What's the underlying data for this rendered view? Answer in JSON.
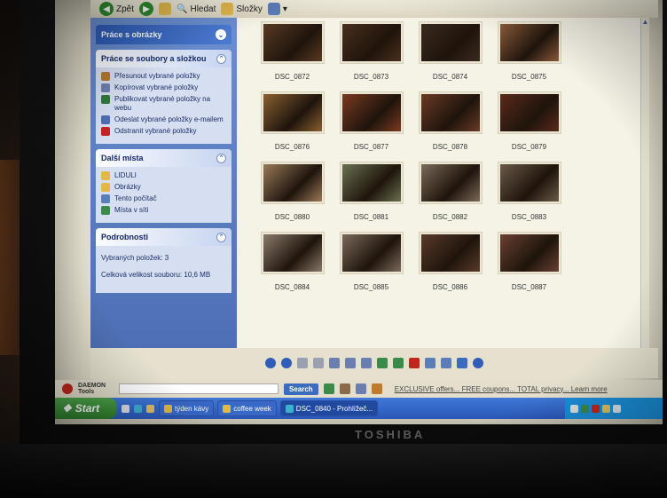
{
  "toolbar": {
    "back_label": "Zpět",
    "search_label": "Hledat",
    "folders_label": "Složky"
  },
  "taskpane": {
    "picture_tasks_title": "Práce s obrázky",
    "file_tasks": {
      "title": "Práce se soubory a složkou",
      "items": [
        {
          "label": "Přesunout vybrané položky",
          "icon": "move-icon",
          "color": "#b57a2e"
        },
        {
          "label": "Kopírovat vybrané položky",
          "icon": "copy-icon",
          "color": "#6f7fb0"
        },
        {
          "label": "Publikovat vybrané položky na webu",
          "icon": "publish-web-icon",
          "color": "#2f7a3a"
        },
        {
          "label": "Odeslat vybrané položky e-mailem",
          "icon": "email-icon",
          "color": "#4d6fb4"
        },
        {
          "label": "Odstranit vybrané položky",
          "icon": "delete-icon",
          "color": "#c0261c"
        }
      ]
    },
    "other_places": {
      "title": "Další místa",
      "items": [
        {
          "label": "LIDULI",
          "icon": "folder-icon",
          "color": "#e1b84a"
        },
        {
          "label": "Obrázky",
          "icon": "folder-icon",
          "color": "#e1b84a"
        },
        {
          "label": "Tento počítač",
          "icon": "computer-icon",
          "color": "#5b7db8"
        },
        {
          "label": "Místa v síti",
          "icon": "network-icon",
          "color": "#3b8a4a"
        }
      ]
    },
    "details": {
      "title": "Podrobnosti",
      "selected": "Vybraných položek: 3",
      "size": "Celková velikost souboru: 10,6 MB"
    }
  },
  "thumbnails": [
    {
      "name": "DSC_0872",
      "color": "#5a3a22"
    },
    {
      "name": "DSC_0873",
      "color": "#4a2f1c"
    },
    {
      "name": "DSC_0874",
      "color": "#3a2a1e"
    },
    {
      "name": "DSC_0875",
      "color": "#8a5a3a"
    },
    {
      "name": "DSC_0876",
      "color": "#8a6030"
    },
    {
      "name": "DSC_0877",
      "color": "#7a3a20"
    },
    {
      "name": "DSC_0878",
      "color": "#6a3a24"
    },
    {
      "name": "DSC_0879",
      "color": "#5a2a1a"
    },
    {
      "name": "DSC_0880",
      "color": "#9a7a5a"
    },
    {
      "name": "DSC_0881",
      "color": "#6a7050"
    },
    {
      "name": "DSC_0882",
      "color": "#7a6a58"
    },
    {
      "name": "DSC_0883",
      "color": "#6a5a48"
    },
    {
      "name": "DSC_0884",
      "color": "#8a7a6a"
    },
    {
      "name": "DSC_0885",
      "color": "#7a6a5a"
    },
    {
      "name": "DSC_0886",
      "color": "#5a3a2a"
    },
    {
      "name": "DSC_0887",
      "color": "#6a4030"
    }
  ],
  "daemon": {
    "label": "DAEMON Tools",
    "search_label": "Search",
    "ad_text": "EXCLUSIVE offers... FREE coupons... TOTAL privacy... Learn more"
  },
  "taskbar": {
    "start_label": "Start",
    "tasks": [
      {
        "label": "týden kávy",
        "active": false
      },
      {
        "label": "coffee week",
        "active": false
      },
      {
        "label": "DSC_0840 - Prohlížeč...",
        "active": true
      }
    ]
  },
  "monitor_brand": "TOSHIBA"
}
